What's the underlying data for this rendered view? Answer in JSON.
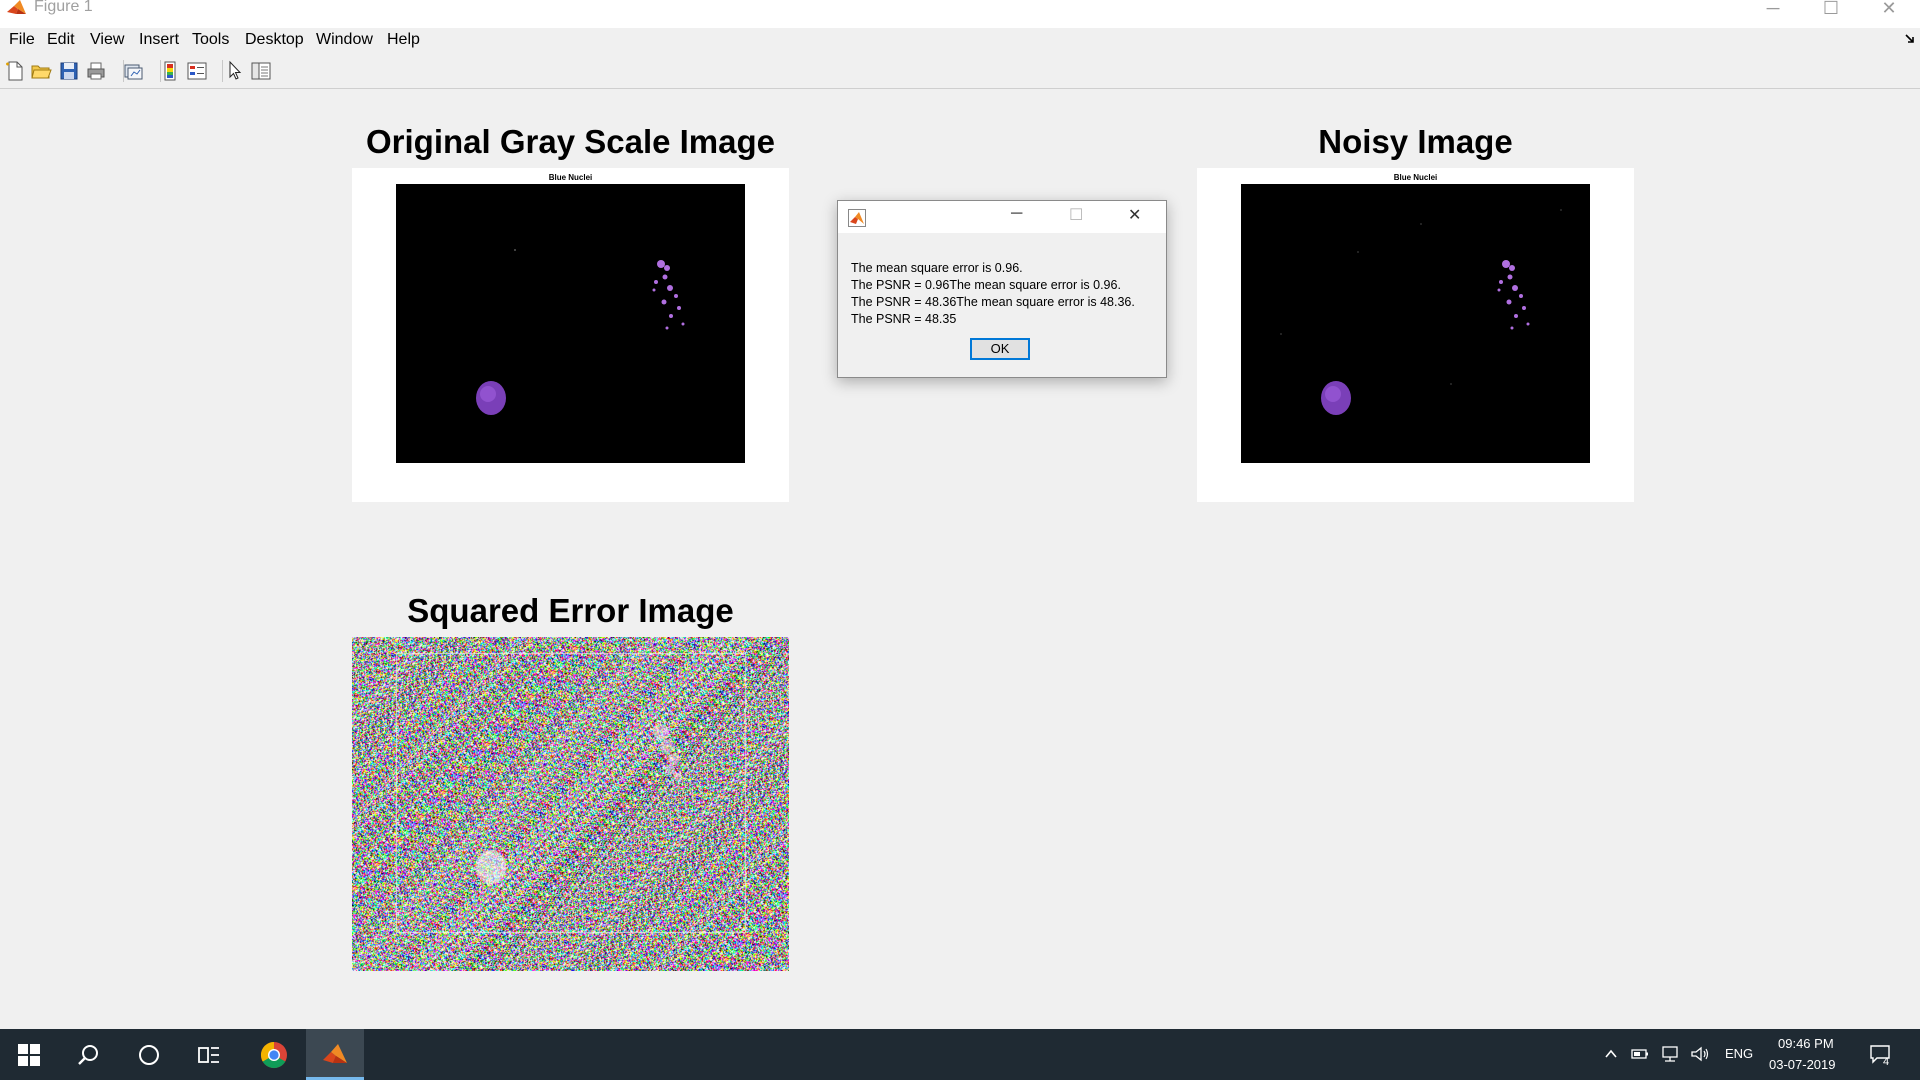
{
  "window": {
    "title": "Figure 1",
    "minimize_glyph": "─",
    "maximize_glyph": "☐",
    "close_glyph": "✕"
  },
  "menu": [
    "File",
    "Edit",
    "View",
    "Insert",
    "Tools",
    "Desktop",
    "Window",
    "Help"
  ],
  "toolbar": {
    "icons": [
      "new-figure-icon",
      "open-file-icon",
      "save-icon",
      "print-icon",
      "link-plot-icon",
      "insert-colorbar-icon",
      "insert-legend-icon",
      "edit-plot-icon",
      "property-inspector-icon"
    ]
  },
  "figure": {
    "original": {
      "title": "Original Gray Scale Image",
      "caption": "Blue Nuclei"
    },
    "noisy": {
      "title": "Noisy Image",
      "caption": "Blue Nuclei"
    },
    "error": {
      "title": "Squared Error Image"
    }
  },
  "dialog": {
    "lines": [
      "The mean square error is 0.96.",
      "The PSNR = 0.96The mean square error is 0.96.",
      "The PSNR = 48.36The mean square error is 48.36.",
      "The PSNR = 48.35"
    ],
    "ok_label": "OK",
    "minimize_glyph": "─",
    "maximize_glyph": "☐",
    "close_glyph": "✕"
  },
  "taskbar": {
    "language": "ENG",
    "time": "09:46 PM",
    "date": "03-07-2019",
    "notification_count": "4",
    "colors": {
      "background": "#1f2a33",
      "active_underline": "#76b9ed"
    }
  }
}
